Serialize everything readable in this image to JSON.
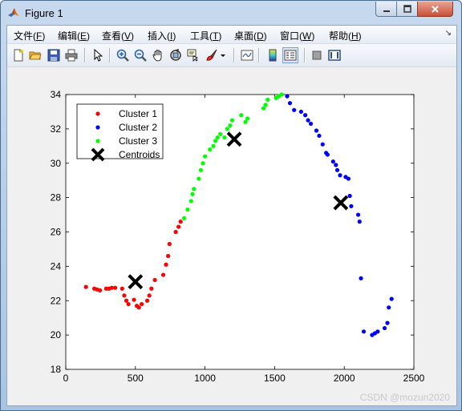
{
  "window": {
    "title": "Figure 1"
  },
  "menu": [
    {
      "label": "文件(",
      "key": "F",
      "suffix": ")"
    },
    {
      "label": "编辑(",
      "key": "E",
      "suffix": ")"
    },
    {
      "label": "查看(",
      "key": "V",
      "suffix": ")"
    },
    {
      "label": "插入(",
      "key": "I",
      "suffix": ")"
    },
    {
      "label": "工具(",
      "key": "T",
      "suffix": ")"
    },
    {
      "label": "桌面(",
      "key": "D",
      "suffix": ")"
    },
    {
      "label": "窗口(",
      "key": "W",
      "suffix": ")"
    },
    {
      "label": "帮助(",
      "key": "H",
      "suffix": ")"
    }
  ],
  "toolbar": [
    "new-figure-icon",
    "open-file-icon",
    "save-icon",
    "print-icon",
    "edit-plot-arrow-icon",
    "zoom-in-icon",
    "zoom-out-icon",
    "pan-hand-icon",
    "rotate-3d-icon",
    "data-cursor-icon",
    "brush-icon",
    "link-plot-icon",
    "colorbar-icon",
    "legend-icon",
    "hide-plot-tools-icon",
    "show-plot-tools-icon"
  ],
  "watermark": "CSDN @mozun2020",
  "colors": {
    "cluster1": "#ff0000",
    "cluster2": "#0000ff",
    "cluster3": "#00ff00",
    "centroid": "#000000"
  },
  "chart_data": {
    "type": "scatter",
    "title": "",
    "xlabel": "",
    "ylabel": "",
    "xlim": [
      0,
      2500
    ],
    "ylim": [
      18,
      34
    ],
    "xticks": [
      0,
      500,
      1000,
      1500,
      2000,
      2500
    ],
    "yticks": [
      18,
      20,
      22,
      24,
      26,
      28,
      30,
      32,
      34
    ],
    "grid": false,
    "legend_position": "top-left",
    "series": [
      {
        "name": "Cluster 1",
        "marker": "dot",
        "color": "#ff0000",
        "points": [
          [
            145,
            22.8
          ],
          [
            205,
            22.7
          ],
          [
            225,
            22.65
          ],
          [
            245,
            22.6
          ],
          [
            290,
            22.7
          ],
          [
            310,
            22.7
          ],
          [
            330,
            22.75
          ],
          [
            355,
            22.75
          ],
          [
            405,
            22.7
          ],
          [
            420,
            22.3
          ],
          [
            435,
            22.0
          ],
          [
            450,
            21.8
          ],
          [
            490,
            22.05
          ],
          [
            510,
            21.7
          ],
          [
            525,
            21.6
          ],
          [
            545,
            21.8
          ],
          [
            585,
            22.0
          ],
          [
            600,
            22.3
          ],
          [
            615,
            22.7
          ],
          [
            640,
            23.2
          ],
          [
            700,
            23.5
          ],
          [
            720,
            24.1
          ],
          [
            735,
            24.6
          ],
          [
            745,
            25.3
          ],
          [
            790,
            26.0
          ],
          [
            810,
            26.3
          ],
          [
            825,
            26.6
          ]
        ]
      },
      {
        "name": "Cluster 2",
        "marker": "dot",
        "color": "#0000ff",
        "points": [
          [
            1590,
            33.9
          ],
          [
            1610,
            33.5
          ],
          [
            1640,
            33.1
          ],
          [
            1690,
            33.0
          ],
          [
            1720,
            32.8
          ],
          [
            1740,
            32.5
          ],
          [
            1760,
            32.3
          ],
          [
            1800,
            31.9
          ],
          [
            1820,
            31.6
          ],
          [
            1845,
            31.1
          ],
          [
            1870,
            30.6
          ],
          [
            1880,
            30.5
          ],
          [
            1920,
            30.1
          ],
          [
            1940,
            29.9
          ],
          [
            1950,
            29.6
          ],
          [
            1970,
            29.3
          ],
          [
            2010,
            29.2
          ],
          [
            2030,
            29.1
          ],
          [
            2040,
            28.1
          ],
          [
            2050,
            27.5
          ],
          [
            2100,
            27.0
          ],
          [
            2110,
            26.6
          ],
          [
            2120,
            23.3
          ],
          [
            2140,
            20.2
          ],
          [
            2200,
            20.0
          ],
          [
            2220,
            20.1
          ],
          [
            2240,
            20.2
          ],
          [
            2290,
            20.4
          ],
          [
            2310,
            20.7
          ],
          [
            2320,
            21.6
          ],
          [
            2340,
            22.1
          ]
        ]
      },
      {
        "name": "Cluster 3",
        "marker": "dot",
        "color": "#00ff00",
        "points": [
          [
            850,
            26.8
          ],
          [
            875,
            27.3
          ],
          [
            900,
            27.8
          ],
          [
            910,
            28.2
          ],
          [
            920,
            28.5
          ],
          [
            955,
            29.1
          ],
          [
            970,
            29.6
          ],
          [
            985,
            30.0
          ],
          [
            1000,
            30.4
          ],
          [
            1035,
            30.8
          ],
          [
            1060,
            31.0
          ],
          [
            1075,
            31.3
          ],
          [
            1090,
            31.5
          ],
          [
            1110,
            31.7
          ],
          [
            1140,
            31.5
          ],
          [
            1160,
            32.0
          ],
          [
            1180,
            32.2
          ],
          [
            1195,
            32.5
          ],
          [
            1260,
            32.8
          ],
          [
            1290,
            32.4
          ],
          [
            1305,
            32.6
          ],
          [
            1420,
            33.2
          ],
          [
            1435,
            33.4
          ],
          [
            1450,
            33.7
          ],
          [
            1510,
            33.8
          ],
          [
            1530,
            33.9
          ],
          [
            1550,
            34.0
          ]
        ]
      },
      {
        "name": "Centroids",
        "marker": "x",
        "color": "#000000",
        "points": [
          [
            500,
            23.1
          ],
          [
            1210,
            31.4
          ],
          [
            1975,
            27.7
          ]
        ]
      }
    ]
  }
}
